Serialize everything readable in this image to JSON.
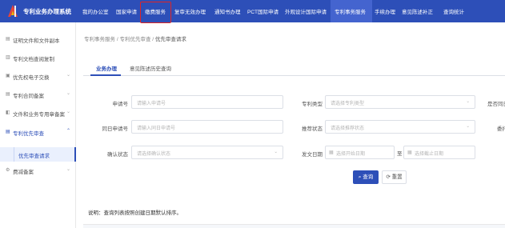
{
  "header": {
    "system_title": "专利业务办理系统",
    "nav": [
      "我的办公室",
      "国家申请",
      "缴费服务",
      "复审无效办理",
      "通知书办理",
      "PCT国际申请",
      "外观设计国际申请",
      "专利事务服务",
      "手续办理",
      "意见陈述补正",
      "查询统计"
    ],
    "highlighted_index": 2,
    "active_index": 7
  },
  "sidebar": {
    "items": [
      {
        "label": "证明文件和文件副本",
        "chevron": ""
      },
      {
        "label": "专利文档查阅复制",
        "chevron": ""
      },
      {
        "label": "优先权电子交换",
        "chevron": "⌄"
      },
      {
        "label": "专利合同备案",
        "chevron": "⌄"
      },
      {
        "label": "文件和业务专用章备案",
        "chevron": "⌄"
      },
      {
        "label": "专利优先审查",
        "chevron": "⌃"
      }
    ],
    "sub_item": "优先审查请求",
    "last_item": {
      "label": "费减备案",
      "chevron": "⌄"
    }
  },
  "breadcrumb": {
    "items": [
      "专利事务服务",
      "专利优先审查",
      "优先审查请求"
    ],
    "separator": "/"
  },
  "tabs": [
    "业务办理",
    "意见陈述历史查询"
  ],
  "form": {
    "row1": {
      "label1": "申请号",
      "placeholder1": "请输入申请号",
      "label2": "专利类型",
      "placeholder2": "请选择专利类型",
      "label3": "是否同日"
    },
    "row2": {
      "label1": "同日申请号",
      "placeholder1": "请输入同日申请号",
      "label2": "推荐状态",
      "placeholder2": "请选择推荐状态",
      "label3": "委托"
    },
    "row3": {
      "label1": "确认状态",
      "placeholder1": "请选择确认状态",
      "label2": "发文日期",
      "placeholder_start": "选择开始日期",
      "range_sep": "至",
      "placeholder_end": "选择截止日期"
    },
    "search_button": "查询",
    "reset_button": "重置"
  },
  "note": "说明：查询列表按照创建日期默认排序。",
  "colors": {
    "primary": "#2d4fb8",
    "highlight_border": "#e02424"
  },
  "icons": {
    "search": "⌕",
    "reset": "⟳",
    "calendar": "▦",
    "dropdown": "⌄"
  }
}
